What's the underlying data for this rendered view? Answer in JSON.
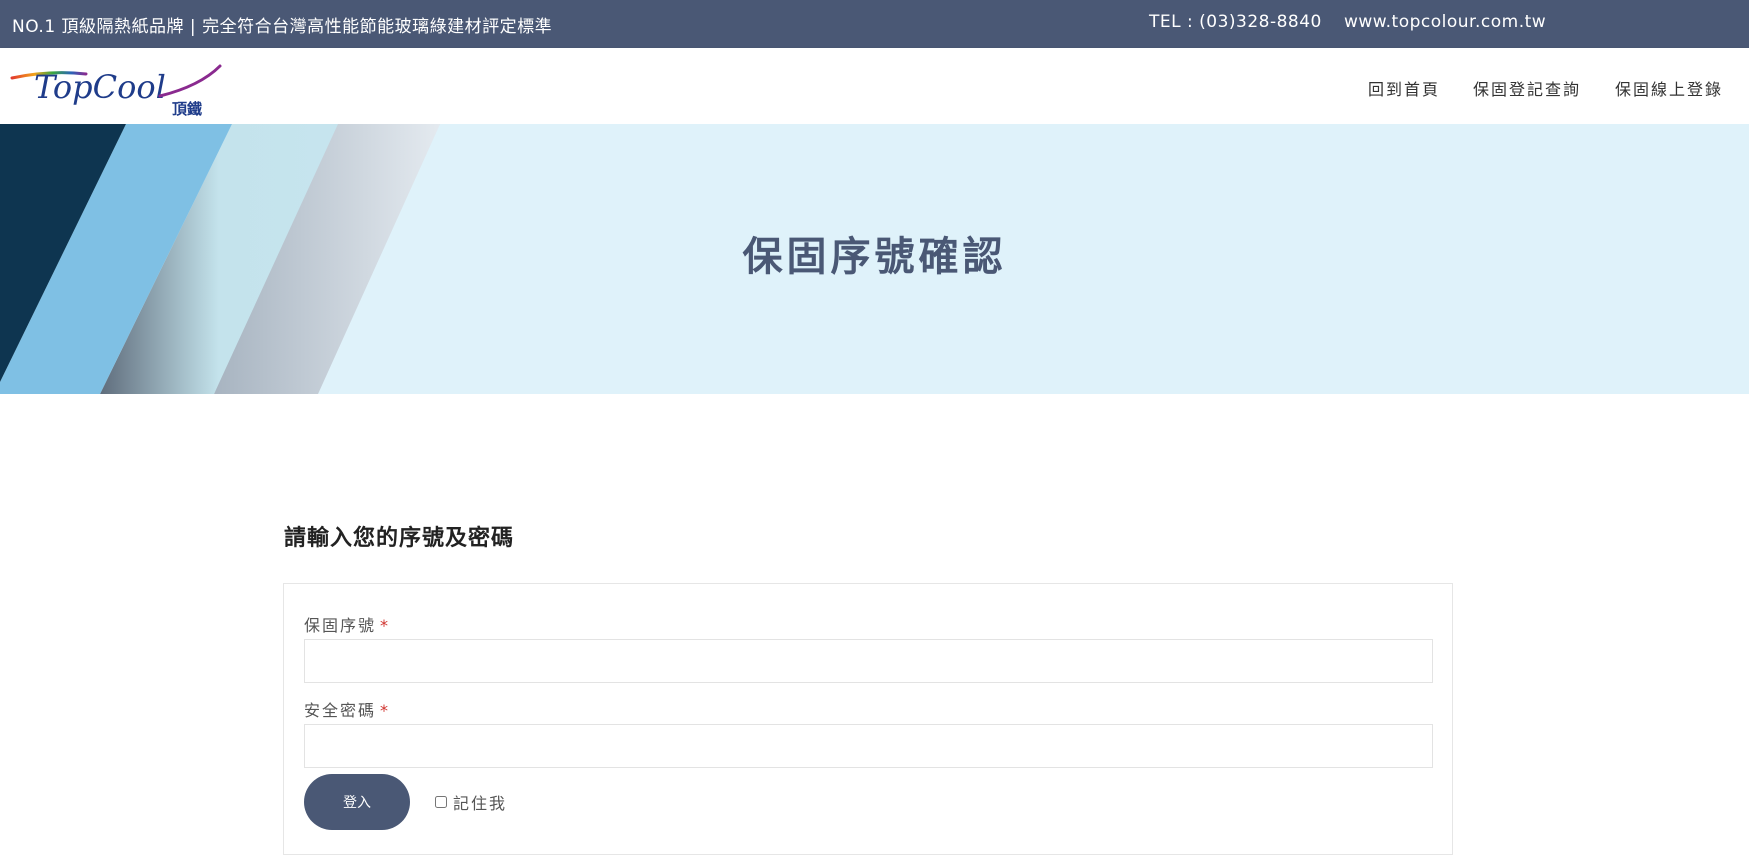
{
  "topbar": {
    "tagline": "NO.1 頂級隔熱紙品牌 | 完全符合台灣高性能節能玻璃綠建材評定標準",
    "tel": "TEL : (03)328-8840",
    "website": "www.topcolour.com.tw"
  },
  "brand": {
    "logo_text": "TopCool",
    "logo_sub": "頂鐵"
  },
  "nav": {
    "home": "回到首頁",
    "warranty_query": "保固登記查詢",
    "warranty_register": "保固線上登錄"
  },
  "hero": {
    "title": "保固序號確認"
  },
  "form": {
    "heading": "請輸入您的序號及密碼",
    "serial_label": "保固序號",
    "serial_value": "",
    "password_label": "安全密碼",
    "password_value": "",
    "required_mark": "*",
    "login_label": "登入",
    "remember_label": "記住我"
  },
  "colors": {
    "brand_navy": "#4a5875",
    "hero_bg": "#dff2fa",
    "required_red": "#d0332e"
  }
}
